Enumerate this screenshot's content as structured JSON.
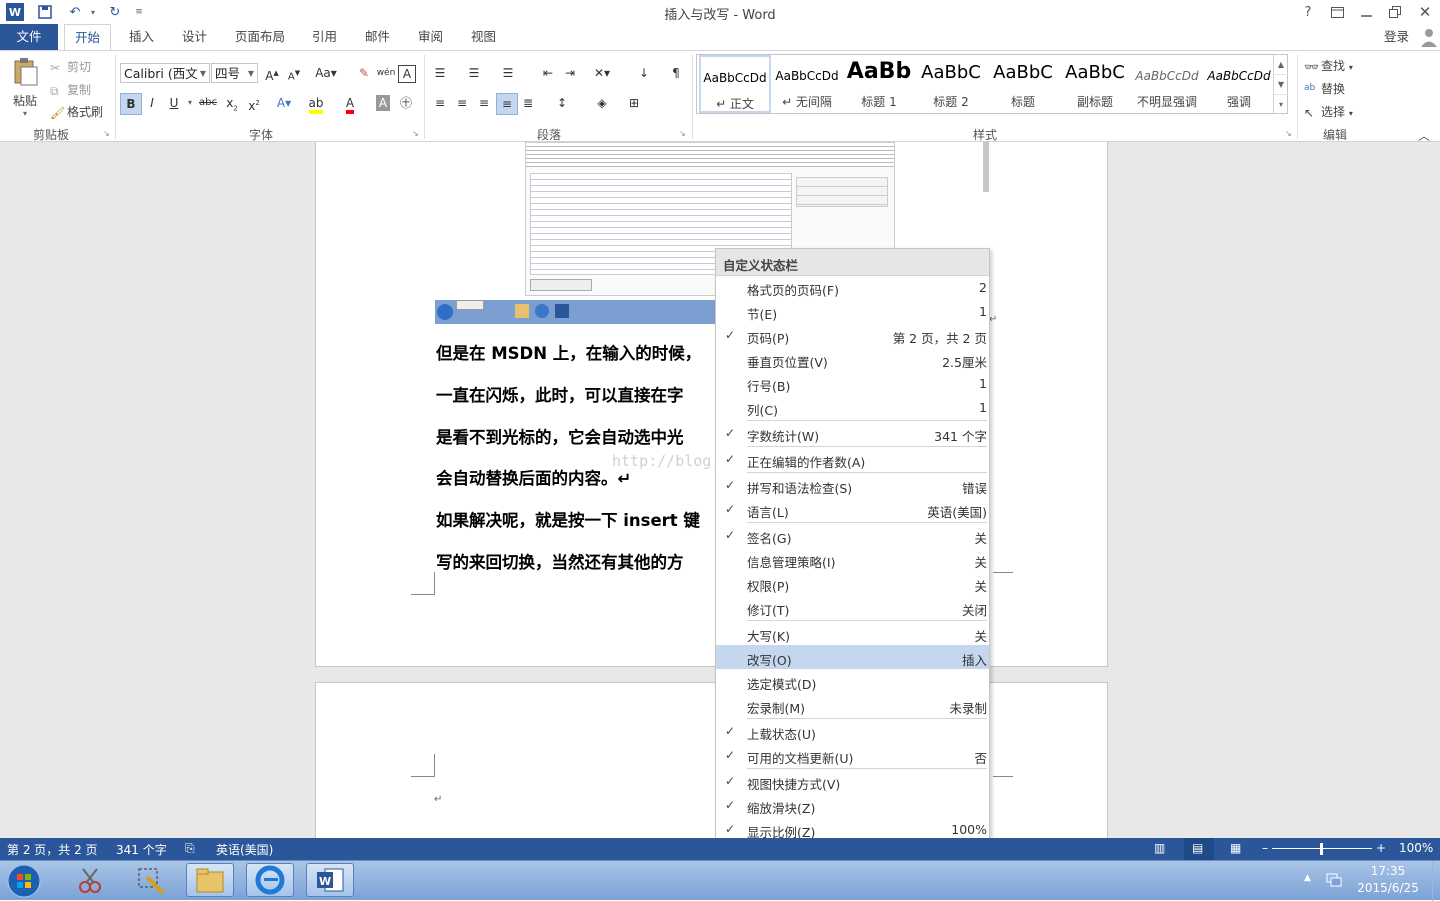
{
  "window": {
    "title": "插入与改写 - Word",
    "help": "?",
    "login": "登录"
  },
  "tabs": [
    {
      "label": "文件"
    },
    {
      "label": "开始"
    },
    {
      "label": "插入"
    },
    {
      "label": "设计"
    },
    {
      "label": "页面布局"
    },
    {
      "label": "引用"
    },
    {
      "label": "邮件"
    },
    {
      "label": "审阅"
    },
    {
      "label": "视图"
    }
  ],
  "ribbon": {
    "clipboard": {
      "paste": "粘贴",
      "cut": "剪切",
      "copy": "复制",
      "format_painter": "格式刷",
      "label": "剪贴板"
    },
    "font": {
      "name": "Calibri (西文",
      "size": "四号",
      "label": "字体"
    },
    "paragraph": {
      "label": "段落"
    },
    "styles": {
      "label": "样式",
      "items": [
        {
          "sample": "AaBbCcDd",
          "name": "↵ 正文"
        },
        {
          "sample": "AaBbCcDd",
          "name": "↵ 无间隔"
        },
        {
          "sample": "AaBb",
          "name": "标题 1"
        },
        {
          "sample": "AaBbC",
          "name": "标题 2"
        },
        {
          "sample": "AaBbC",
          "name": "标题"
        },
        {
          "sample": "AaBbC",
          "name": "副标题"
        },
        {
          "sample": "AaBbCcDd",
          "name": "不明显强调"
        },
        {
          "sample": "AaBbCcDd",
          "name": "强调"
        }
      ]
    },
    "editing": {
      "find": "查找",
      "replace": "替换",
      "select": "选择",
      "label": "编辑"
    }
  },
  "document": {
    "lines": [
      "但是在 MSDN 上，在输入的时候，",
      "一直在闪烁，此时，可以直接在字",
      "是看不到光标的，它会自动选中光",
      "会自动替换后面的内容。↵",
      "如果解决呢，就是按一下 insert 键",
      "写的来回切换，当然还有其他的方"
    ],
    "watermark": "http://blog.csdn.net/..."
  },
  "context_menu": {
    "title": "自定义状态栏",
    "items": [
      {
        "label": "格式页的页码(F)",
        "value": "2",
        "checked": false
      },
      {
        "label": "节(E)",
        "value": "1",
        "checked": false
      },
      {
        "label": "页码(P)",
        "value": "第 2 页，共 2 页",
        "checked": true
      },
      {
        "label": "垂直页位置(V)",
        "value": "2.5厘米",
        "checked": false
      },
      {
        "label": "行号(B)",
        "value": "1",
        "checked": false
      },
      {
        "label": "列(C)",
        "value": "1",
        "checked": false
      },
      {
        "label": "字数统计(W)",
        "value": "341 个字",
        "checked": true
      },
      {
        "label": "正在编辑的作者数(A)",
        "value": "",
        "checked": true
      },
      {
        "label": "拼写和语法检查(S)",
        "value": "错误",
        "checked": true
      },
      {
        "label": "语言(L)",
        "value": "英语(美国)",
        "checked": true
      },
      {
        "label": "签名(G)",
        "value": "关",
        "checked": true
      },
      {
        "label": "信息管理策略(I)",
        "value": "关",
        "checked": false
      },
      {
        "label": "权限(P)",
        "value": "关",
        "checked": false
      },
      {
        "label": "修订(T)",
        "value": "关闭",
        "checked": false
      },
      {
        "label": "大写(K)",
        "value": "关",
        "checked": false
      },
      {
        "label": "改写(O)",
        "value": "插入",
        "checked": false,
        "highlighted": true
      },
      {
        "label": "选定模式(D)",
        "value": "",
        "checked": false
      },
      {
        "label": "宏录制(M)",
        "value": "未录制",
        "checked": false
      },
      {
        "label": "上载状态(U)",
        "value": "",
        "checked": true
      },
      {
        "label": "可用的文档更新(U)",
        "value": "否",
        "checked": true
      },
      {
        "label": "视图快捷方式(V)",
        "value": "",
        "checked": true
      },
      {
        "label": "缩放滑块(Z)",
        "value": "",
        "checked": true
      },
      {
        "label": "显示比例(Z)",
        "value": "100%",
        "checked": true
      }
    ]
  },
  "statusbar": {
    "page": "第 2 页，共 2 页",
    "words": "341 个字",
    "language": "英语(美国)",
    "zoom": "100%"
  },
  "taskbar": {
    "time": "17:35",
    "date": "2015/6/25"
  },
  "colors": {
    "accent": "#2b579a",
    "highlight": "#c5d7ee"
  }
}
